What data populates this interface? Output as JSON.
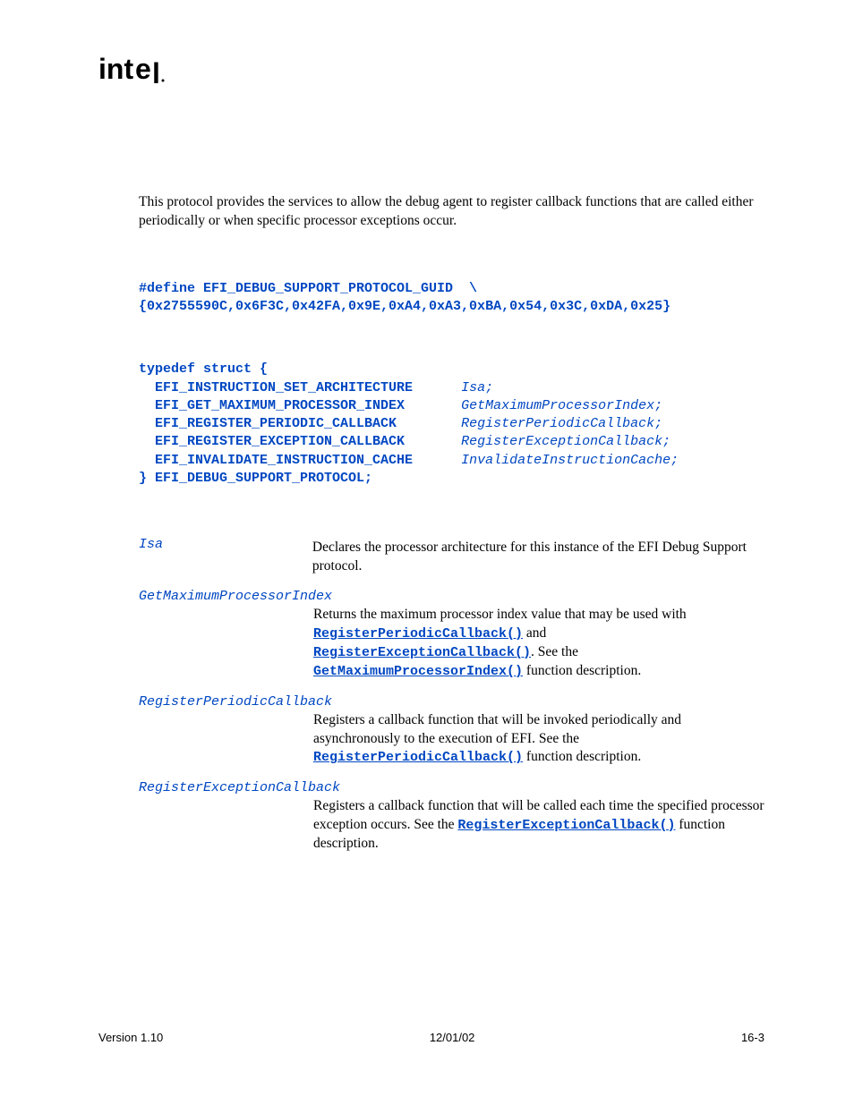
{
  "logo_text": "intel",
  "intro": "This protocol provides the services to allow the debug agent to register callback functions that are called either periodically or when specific processor exceptions occur.",
  "guid": {
    "l1": "#define EFI_DEBUG_SUPPORT_PROTOCOL_GUID  \\",
    "l2": "{0x2755590C,0x6F3C,0x42FA,0x9E,0xA4,0xA3,0xBA,0x54,0x3C,0xDA,0x25}"
  },
  "struct": {
    "open": "typedef struct {",
    "rows": [
      {
        "type": "EFI_INSTRUCTION_SET_ARCHITECTURE",
        "member": "Isa;"
      },
      {
        "type": "EFI_GET_MAXIMUM_PROCESSOR_INDEX",
        "member": "GetMaximumProcessorIndex;"
      },
      {
        "type": "EFI_REGISTER_PERIODIC_CALLBACK",
        "member": "RegisterPeriodicCallback;"
      },
      {
        "type": "EFI_REGISTER_EXCEPTION_CALLBACK",
        "member": "RegisterExceptionCallback;"
      },
      {
        "type": "EFI_INVALIDATE_INSTRUCTION_CACHE",
        "member": "InvalidateInstructionCache;"
      }
    ],
    "close": "} EFI_DEBUG_SUPPORT_PROTOCOL;"
  },
  "params": {
    "isa": {
      "name": "Isa",
      "desc": "Declares the processor architecture for this instance of the EFI Debug Support protocol."
    },
    "gmpi": {
      "name": "GetMaximumProcessorIndex",
      "d1": "Returns the maximum processor index value that may be used with ",
      "f1": "RegisterPeriodicCallback()",
      "d2": " and ",
      "f2": "RegisterExceptionCallback()",
      "d3": ".  See the ",
      "f3": "GetMaximumProcessorIndex()",
      "d4": " function description."
    },
    "rpc": {
      "name": "RegisterPeriodicCallback",
      "d1": "Registers a callback function that will be invoked periodically and asynchronously to the execution of EFI.  See the ",
      "f1": "RegisterPeriodicCallback()",
      "d2": " function description."
    },
    "rec": {
      "name": "RegisterExceptionCallback",
      "d1": "Registers a callback function that will be called each time the specified processor exception occurs.  See the ",
      "f1": "RegisterExceptionCallback()",
      "d2": " function description."
    }
  },
  "footer": {
    "version": "Version 1.10",
    "date": "12/01/02",
    "page": "16-3"
  }
}
